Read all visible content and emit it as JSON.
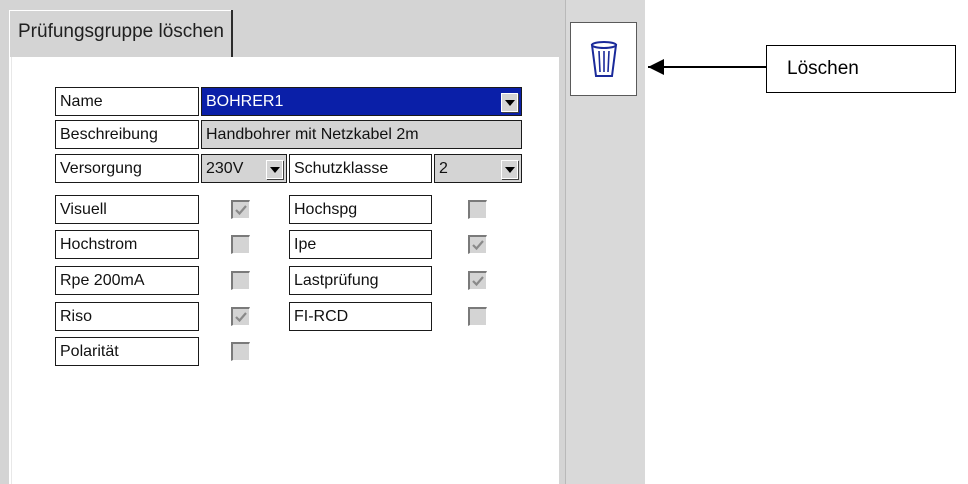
{
  "header": {
    "tab_title": "Prüfungsgruppe löschen"
  },
  "toolbar": {
    "delete_icon": "trash-icon"
  },
  "form": {
    "name_label": "Name",
    "name_value": "BOHRER1",
    "description_label": "Beschreibung",
    "description_value": "Handbohrer mit Netzkabel 2m",
    "supply_label": "Versorgung",
    "supply_value": "230V",
    "protection_class_label": "Schutzklasse",
    "protection_class_value": "2",
    "tests_left": [
      {
        "label": "Visuell",
        "checked": true
      },
      {
        "label": "Hochstrom",
        "checked": false
      },
      {
        "label": "Rpe 200mA",
        "checked": false
      },
      {
        "label": "Riso",
        "checked": true
      },
      {
        "label": "Polarität",
        "checked": false
      }
    ],
    "tests_right": [
      {
        "label": "Hochspg",
        "checked": false
      },
      {
        "label": "Ipe",
        "checked": true
      },
      {
        "label": "Lastprüfung",
        "checked": true
      },
      {
        "label": "FI-RCD",
        "checked": false
      }
    ]
  },
  "callout": {
    "label": "Löschen"
  },
  "colors": {
    "selection": "#0a1fa8",
    "screen_bg": "#d4d4d4",
    "panel_bg": "#ffffff"
  }
}
